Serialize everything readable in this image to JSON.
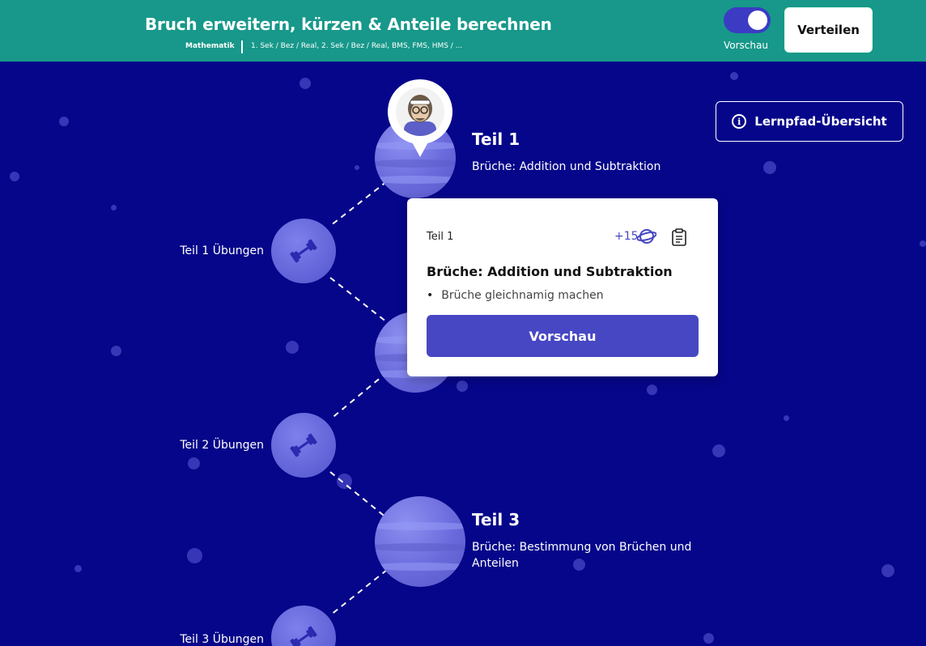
{
  "header": {
    "title": "Bruch erweitern, kürzen & Anteile berechnen",
    "subject": "Mathematik",
    "levels": "1. Sek / Bez / Real, 2. Sek / Bez / Real, BMS, FMS, HMS / ...",
    "toggle_label": "Vorschau",
    "toggle_on": true,
    "share_label": "Verteilen"
  },
  "overview_button": {
    "label": "Lernpfad-Übersicht",
    "icon": "info-icon"
  },
  "path": {
    "parts": [
      {
        "title": "Teil 1",
        "subtitle": "Brüche: Addition und Subtraktion"
      },
      {
        "title": "Teil 3",
        "subtitle_line1": "Brüche: Bestimmung von Brüchen und",
        "subtitle_line2": "Anteilen"
      }
    ],
    "exercises": [
      {
        "label": "Teil 1 Übungen",
        "icon": "dumbbell-icon"
      },
      {
        "label": "Teil 2 Übungen",
        "icon": "dumbbell-icon"
      },
      {
        "label": "Teil 3 Übungen",
        "icon": "dumbbell-icon"
      }
    ]
  },
  "popup": {
    "part": "Teil 1",
    "points": "+15",
    "title": "Brüche: Addition und Subtraktion",
    "bullet": "Brüche gleichnamig machen",
    "button": "Vorschau"
  },
  "colors": {
    "header_bg": "#17988a",
    "space_bg": "#06068a",
    "accent": "#4747c4"
  }
}
